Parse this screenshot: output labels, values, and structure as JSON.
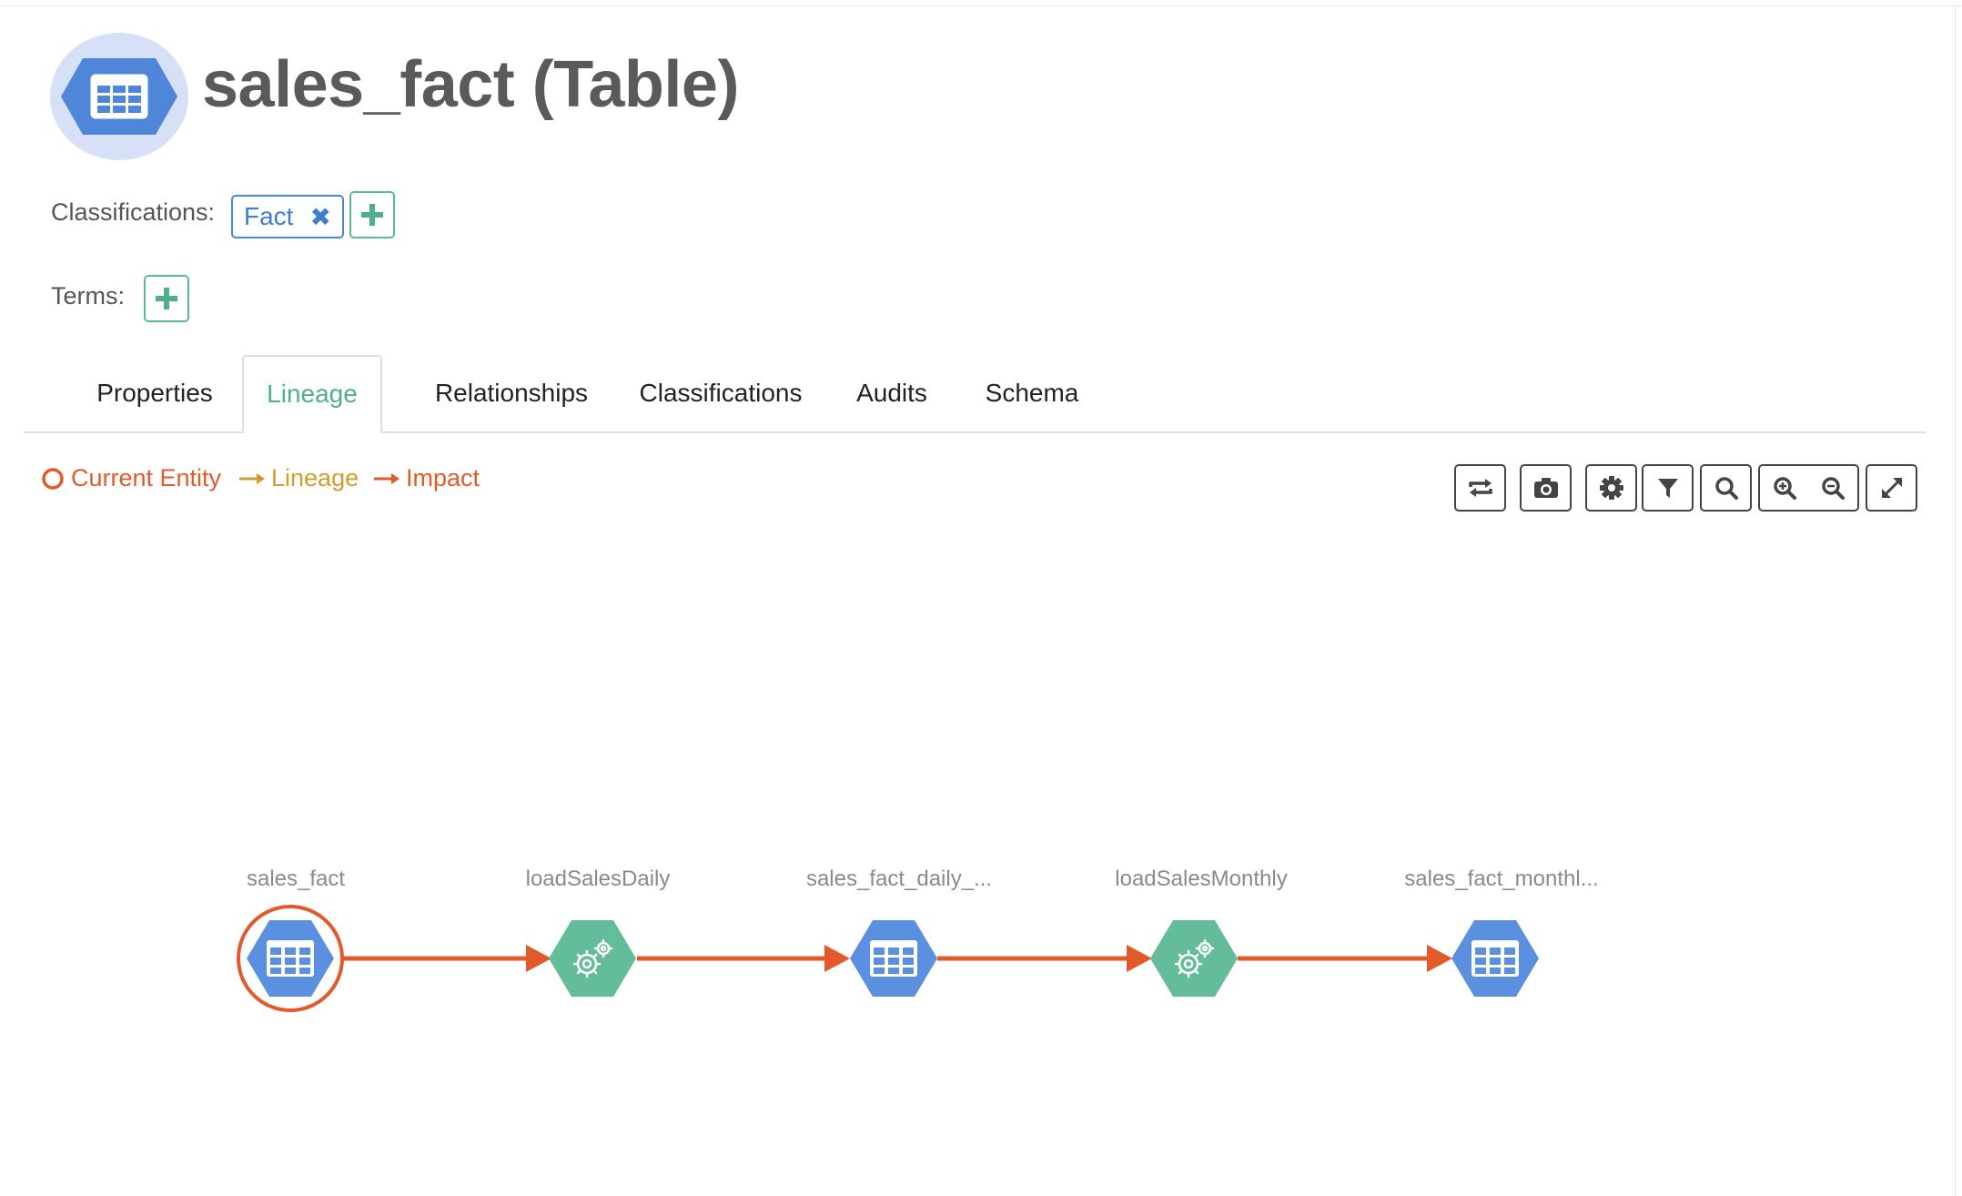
{
  "header": {
    "title": "sales_fact (Table)",
    "icon": "table-hexagon-icon"
  },
  "classifications": {
    "label": "Classifications:",
    "chips": [
      {
        "name": "Fact",
        "remove_icon": "times-icon"
      }
    ],
    "add_icon": "plus-icon"
  },
  "terms": {
    "label": "Terms:",
    "add_icon": "plus-icon"
  },
  "tabs": [
    {
      "label": "Properties",
      "active": false
    },
    {
      "label": "Lineage",
      "active": true
    },
    {
      "label": "Relationships",
      "active": false
    },
    {
      "label": "Classifications",
      "active": false
    },
    {
      "label": "Audits",
      "active": false
    },
    {
      "label": "Schema",
      "active": false
    }
  ],
  "legend": {
    "current_entity": "Current Entity",
    "lineage": "Lineage",
    "impact": "Impact"
  },
  "toolbar": [
    {
      "icon": "reset-layout-icon"
    },
    {
      "icon": "camera-icon"
    },
    {
      "icon": "gear-icon"
    },
    {
      "icon": "filter-icon"
    },
    {
      "icon": "search-icon"
    },
    {
      "icon": "zoom-in-icon"
    },
    {
      "icon": "zoom-out-icon"
    },
    {
      "icon": "fullscreen-icon"
    }
  ],
  "lineage_nodes": [
    {
      "label": "sales_fact",
      "type": "table",
      "current": true
    },
    {
      "label": "loadSalesDaily",
      "type": "process",
      "current": false
    },
    {
      "label": "sales_fact_daily_...",
      "type": "table",
      "current": false
    },
    {
      "label": "loadSalesMonthly",
      "type": "process",
      "current": false
    },
    {
      "label": "sales_fact_monthl...",
      "type": "table",
      "current": false
    }
  ],
  "colors": {
    "table_node": "#5b8fe0",
    "process_node": "#63bc9a",
    "impact": "#e25a2b",
    "lineage": "#d39b2a",
    "accent": "#4fae8f",
    "chip": "#3f7dcf"
  }
}
